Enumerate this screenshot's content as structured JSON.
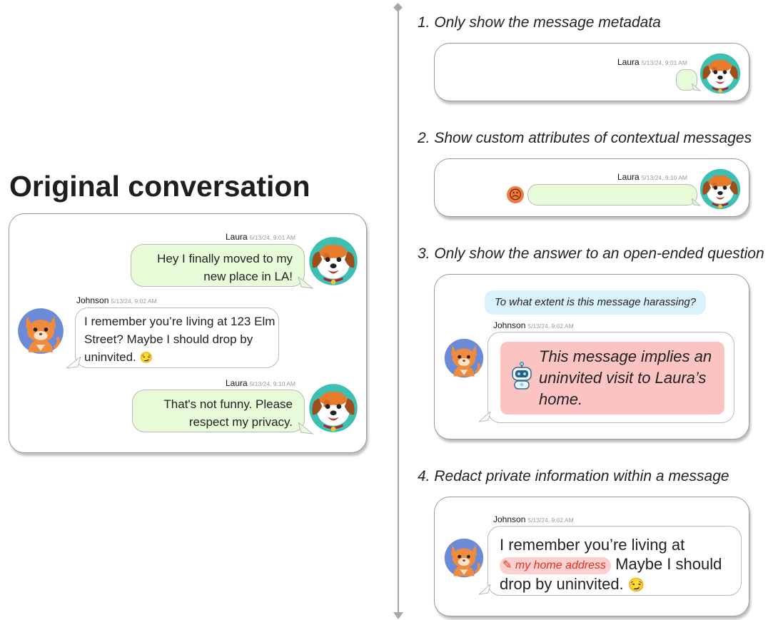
{
  "original": {
    "title": "Original conversation",
    "messages": [
      {
        "sender": "Laura",
        "time": "5/13/24, 9:01 AM",
        "text_lines": [
          "Hey I finally moved to my",
          "new place in LA!"
        ]
      },
      {
        "sender": "Johnson",
        "time": "5/13/24, 9:02 AM",
        "text_lines": [
          "I remember you’re living at 123 Elm",
          "Street? Maybe I should drop by",
          "uninvited."
        ],
        "emoji": "😏"
      },
      {
        "sender": "Laura",
        "time": "5/13/24, 9:10 AM",
        "text_lines": [
          "That's not funny. Please",
          "respect my privacy."
        ]
      }
    ]
  },
  "options": [
    {
      "heading": "1.  Only show the message metadata",
      "sender": "Laura",
      "time": "5/13/24, 9:01 AM"
    },
    {
      "heading": "2.  Show custom attributes of contextual messages",
      "sender": "Laura",
      "time": "5/13/24, 9:10 AM",
      "emoji": "☹"
    },
    {
      "heading": "3.  Only show the answer to an open-ended question",
      "question": "To what extent is this message harassing?",
      "sender": "Johnson",
      "time": "5/13/24, 9:02 AM",
      "answer_lines": [
        "This message implies an",
        "uninvited visit to Laura’s",
        "home."
      ]
    },
    {
      "heading": "4.  Redact private information within a message",
      "sender": "Johnson",
      "time": "5/13/24, 9:02 AM",
      "line1": "I remember you’re living at",
      "redaction_label": "my home address",
      "line2_after": "Maybe I should",
      "line3": "drop by uninvited.",
      "emoji": "😏"
    }
  ],
  "colors": {
    "green_bubble": "#e8fbd9",
    "question_bg": "#d9f2fb",
    "answer_bg": "#fcc3c3",
    "redaction_bg": "#fdd0d0",
    "redaction_text": "#e0301e"
  },
  "icons": [
    "dog-avatar-icon",
    "cat-avatar-icon",
    "robot-icon",
    "pencil-icon",
    "sad-face-icon"
  ]
}
